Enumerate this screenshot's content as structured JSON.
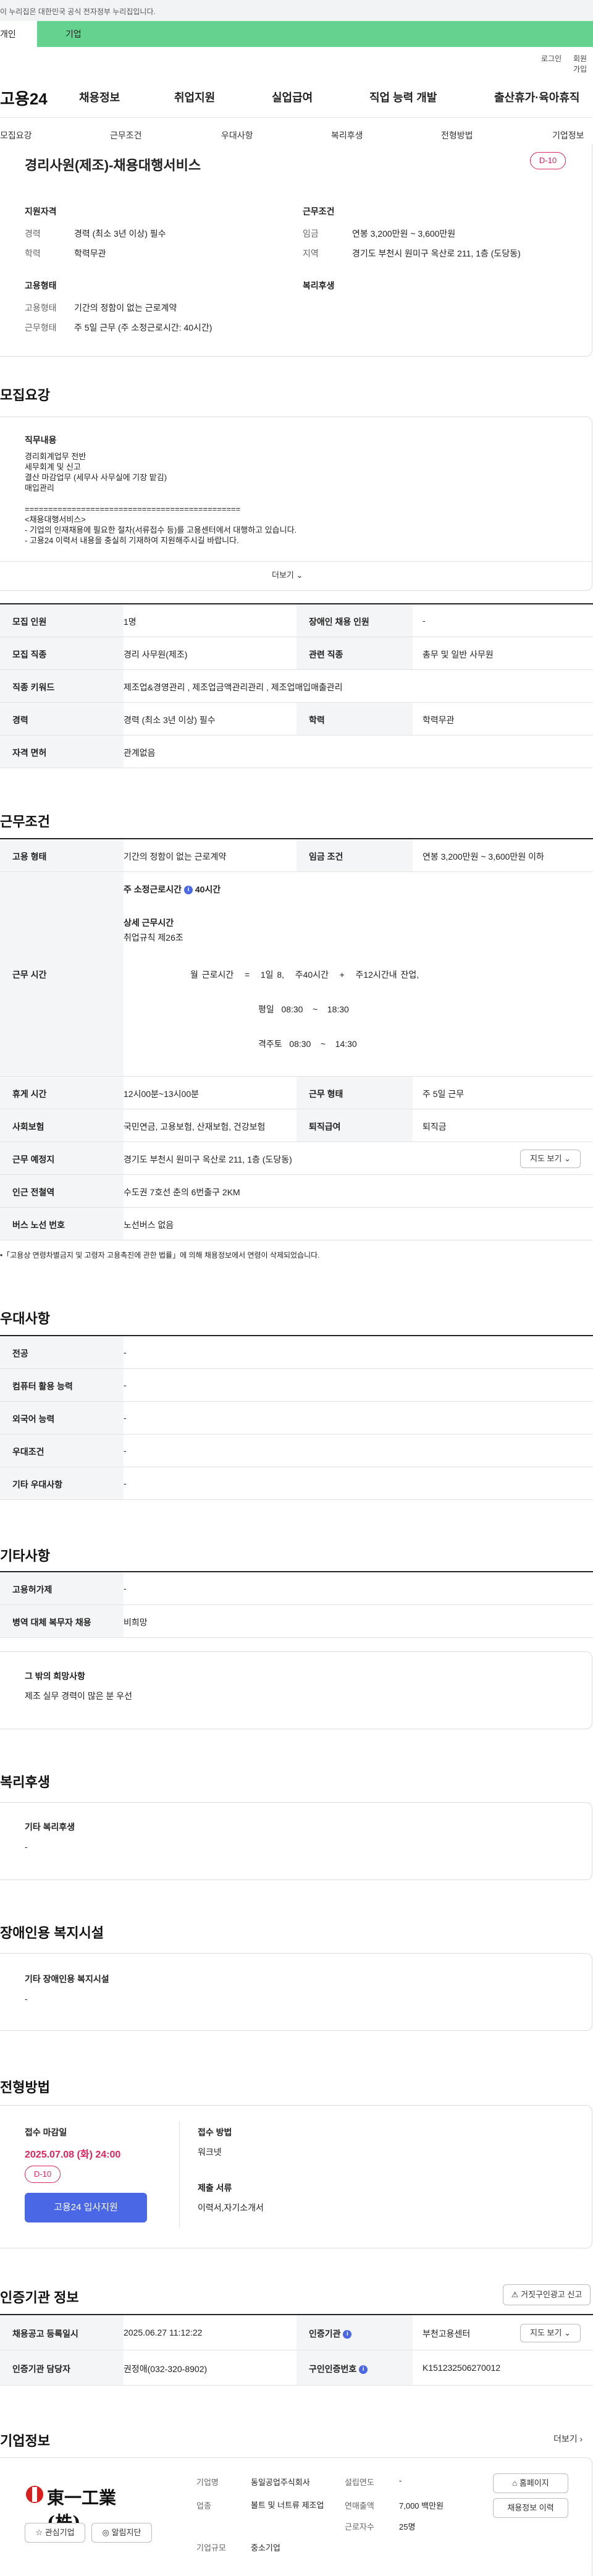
{
  "gov_banner": "이 누리집은 대한민국 공식 전자정부 누리집입니다.",
  "tabs": {
    "individual": "개인",
    "business": "기업"
  },
  "util": {
    "login": "로그인",
    "signup": "회원가입"
  },
  "gnb": {
    "logo": "고용24",
    "menus": [
      "채용정보",
      "취업지원",
      "실업급여",
      "직업 능력 개발",
      "출산휴가·육아휴직"
    ]
  },
  "subnav": [
    "모집요강",
    "근무조건",
    "우대사항",
    "복리후생",
    "전형방법",
    "기업정보"
  ],
  "summary": {
    "title": "경리사원(제조)-채용대행서비스",
    "dday": "D-10",
    "qual_head": "지원자격",
    "qual": [
      {
        "label": "경력",
        "value": "경력 (최소 3년 이상) 필수"
      },
      {
        "label": "학력",
        "value": "학력무관"
      }
    ],
    "cond_head": "근무조건",
    "cond": [
      {
        "label": "임금",
        "value": "연봉 3,200만원 ~ 3,600만원"
      },
      {
        "label": "지역",
        "value": "경기도 부천시 원미구 옥산로 211, 1층 (도당동)"
      }
    ],
    "emp_head": "고용형태",
    "emp": [
      {
        "label": "고용형태",
        "value": "기간의 정함이 없는 근로계약"
      },
      {
        "label": "근무형태",
        "value": "주 5일 근무 (주 소정근로시간: 40시간)"
      }
    ],
    "welfare_head": "복리후생"
  },
  "recruit": {
    "heading": "모집요강",
    "duty_head": "직무내용",
    "duty_lines": [
      "경리회계업무 전반",
      "세무회계 및 신고",
      "결산 마감업무 (세무사 사무실에 기장 맡김)",
      "매입관리",
      "",
      "==============================================",
      "<채용대행서비스>",
      "- 기업의 인재채용에 필요한 절차(서류접수 등)를 고용센터에서 대행하고 있습니다.",
      "- 고용24 이력서 내용을 충실히 기재하여 지원해주시길 바랍니다."
    ],
    "more": "더보기",
    "rows": [
      {
        "l1": "모집 인원",
        "v1": "1명",
        "l2": "장애인 채용 인원",
        "v2": "-"
      },
      {
        "l1": "모집 직종",
        "v1": "경리 사무원(제조)",
        "l2": "관련 직종",
        "v2": "총무 및 일반 사무원"
      },
      {
        "l1": "직종 키워드",
        "v1": "제조업&경영관리 , 제조업금액관리관리 , 제조업매입매출관리"
      },
      {
        "l1": "경력",
        "v1": "경력 (최소 3년 이상) 필수",
        "l2": "학력",
        "v2": "학력무관"
      },
      {
        "l1": "자격 면허",
        "v1": "관계없음"
      }
    ]
  },
  "conditions": {
    "heading": "근무조건",
    "emp_type_l": "고용 형태",
    "emp_type_v": "기간의 정함이 없는 근로계약",
    "wage_l": "임금 조건",
    "wage_v": "연봉 3,200만원 ~ 3,600만원 이하",
    "hours_l": "근무 시간",
    "weekly_hours": "주 소정근로시간",
    "weekly_hours_v": "40시간",
    "detail_head": "상세 근무시간",
    "detail_rule": "취업규칙 제26조",
    "formula": [
      "월 근로시간",
      "=",
      "1일 8,",
      "주40시간",
      "+",
      "주12시간내 잔업,"
    ],
    "weekday": [
      "평일",
      "08:30",
      "~",
      "18:30"
    ],
    "alt_week": [
      "격주토",
      "08:30",
      "~",
      "14:30"
    ],
    "break_l": "휴게 시간",
    "break_v": "12시00분~13시00분",
    "work_type_l": "근무 형태",
    "work_type_v": "주 5일 근무",
    "insurance_l": "사회보험",
    "insurance_v": "국민연금, 고용보험, 산재보험, 건강보험",
    "severance_l": "퇴직급여",
    "severance_v": "퇴직금",
    "place_l": "근무 예정지",
    "place_v": "경기도 부천시 원미구 옥산로 211, 1층 (도당동)",
    "map_btn": "지도 보기",
    "subway_l": "인근 전철역",
    "subway_v": "수도권 7호선 춘의 6번출구 2KM",
    "bus_l": "버스 노선 번호",
    "bus_v": "노선버스 없음",
    "note": "「고용상 연령차별금지 및 고령자 고용촉진에 관한 법률」에 의해 채용정보에서 연령이 삭제되었습니다."
  },
  "prefs": {
    "heading": "우대사항",
    "rows": [
      {
        "l": "전공",
        "v": "-"
      },
      {
        "l": "컴퓨터 활용 능력",
        "v": "-"
      },
      {
        "l": "외국어 능력",
        "v": "-"
      },
      {
        "l": "우대조건",
        "v": "-"
      },
      {
        "l": "기타 우대사항",
        "v": "-"
      }
    ]
  },
  "others": {
    "heading": "기타사항",
    "rows": [
      {
        "l": "고용허가제",
        "v": "-"
      },
      {
        "l": "병역 대체 복무자 채용",
        "v": "비희망"
      }
    ],
    "hope_head": "그 밖의 희망사항",
    "hope_v": "제조 실무 경력이 많은 분 우선"
  },
  "welfare": {
    "heading": "복리후생",
    "box_head": "기타 복리후생",
    "box_v": "-"
  },
  "disabled": {
    "heading": "장애인용 복지시설",
    "box_head": "기타 장애인용 복지시설",
    "box_v": "-"
  },
  "selection": {
    "heading": "전형방법",
    "deadline_head": "접수 마감일",
    "deadline": "2025.07.08 (화) 24:00",
    "dday": "D-10",
    "apply_btn": "고용24 입사지원",
    "method_head": "접수 방법",
    "method_v": "워크넷",
    "docs_head": "제출 서류",
    "docs_v": "이력서,자기소개서"
  },
  "cert": {
    "heading": "인증기관 정보",
    "report_btn": "거짓구인광고 신고",
    "reg_date_l": "채용공고 등록일시",
    "reg_date_v": "2025.06.27 11:12:22",
    "agency_l": "인증기관",
    "agency_v": "부천고용센터",
    "map_btn": "지도 보기",
    "manager_l": "인증기관 담당자",
    "manager_v": "권정애(032-320-8902)",
    "cert_no_l": "구인인증번호",
    "cert_no_v": "K151232506270012"
  },
  "company": {
    "heading": "기업정보",
    "more": "더보기",
    "logo_text": "東一工業(株)",
    "fav_btn": "관심기업",
    "follow_btn": "알림지단",
    "f1": [
      {
        "l": "기업명",
        "v": "동일공업주식회사"
      },
      {
        "l": "업종",
        "v": "볼트 및 너트류 제조업"
      },
      {
        "l": "기업규모",
        "v": "중소기업"
      }
    ],
    "f2": [
      {
        "l": "설립연도",
        "v": "-"
      },
      {
        "l": "연매출액",
        "v": "7,000 백만원"
      },
      {
        "l": "근로자수",
        "v": "25명"
      }
    ],
    "homepage_btn": "홈페이지",
    "jobs_btn": "채용정보 이력"
  },
  "colors": {
    "accent": "#4a67e6",
    "danger": "#e0245e",
    "tab_green": "#63d38f"
  }
}
